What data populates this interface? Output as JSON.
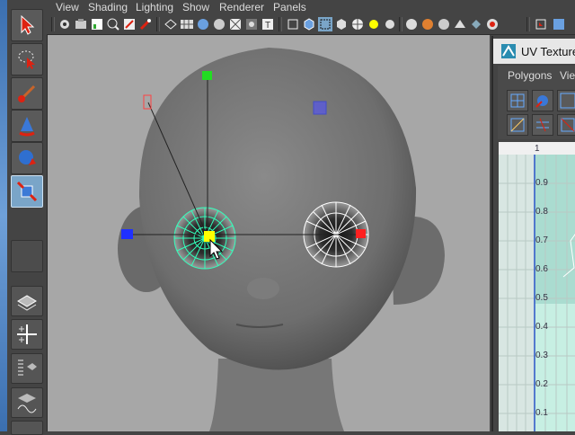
{
  "menus": {
    "view": "View",
    "shading": "Shading",
    "lighting": "Lighting",
    "show": "Show",
    "renderer": "Renderer",
    "panels": "Panels"
  },
  "uv_editor": {
    "title": "UV Texture",
    "menu_polygons": "Polygons",
    "menu_view": "View",
    "column_label": "1",
    "axis_labels": [
      "0.9",
      "0.8",
      "0.7",
      "0.6",
      "0.5",
      "0.4",
      "0.3",
      "0.2",
      "0.1"
    ]
  },
  "colors": {
    "x_handle": "#ff2020",
    "y_handle": "#22dd22",
    "z_handle": "#2030ff",
    "pivot": "#ffff00",
    "selection_uv": "#33ffbb"
  },
  "icons": {
    "select": "arrow-icon",
    "lasso": "lasso-select-icon",
    "paint": "paint-select-icon",
    "move": "move-tool-icon",
    "rotate": "rotate-tool-icon",
    "scale": "scale-tool-icon"
  }
}
